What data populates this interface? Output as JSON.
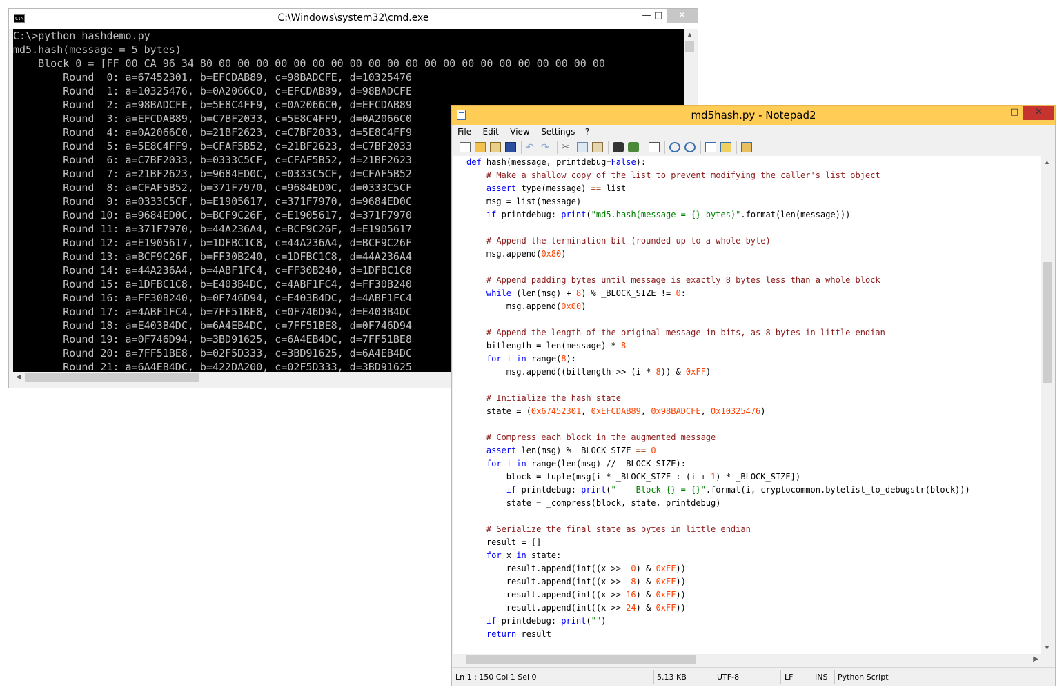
{
  "cmd": {
    "title": "C:\\Windows\\system32\\cmd.exe",
    "lines": [
      "C:\\>python hashdemo.py",
      "md5.hash(message = 5 bytes)",
      "    Block 0 = [FF 00 CA 96 34 80 00 00 00 00 00 00 00 00 00 00 00 00 00 00 00 00 00 00 00 00 00",
      "        Round  0: a=67452301, b=EFCDAB89, c=98BADCFE, d=10325476",
      "        Round  1: a=10325476, b=0A2066C0, c=EFCDAB89, d=98BADCFE",
      "        Round  2: a=98BADCFE, b=5E8C4FF9, c=0A2066C0, d=EFCDAB89",
      "        Round  3: a=EFCDAB89, b=C7BF2033, c=5E8C4FF9, d=0A2066C0",
      "        Round  4: a=0A2066C0, b=21BF2623, c=C7BF2033, d=5E8C4FF9",
      "        Round  5: a=5E8C4FF9, b=CFAF5B52, c=21BF2623, d=C7BF2033",
      "        Round  6: a=C7BF2033, b=0333C5CF, c=CFAF5B52, d=21BF2623",
      "        Round  7: a=21BF2623, b=9684ED0C, c=0333C5CF, d=CFAF5B52",
      "        Round  8: a=CFAF5B52, b=371F7970, c=9684ED0C, d=0333C5CF",
      "        Round  9: a=0333C5CF, b=E1905617, c=371F7970, d=9684ED0C",
      "        Round 10: a=9684ED0C, b=BCF9C26F, c=E1905617, d=371F7970",
      "        Round 11: a=371F7970, b=44A236A4, c=BCF9C26F, d=E1905617",
      "        Round 12: a=E1905617, b=1DFBC1C8, c=44A236A4, d=BCF9C26F",
      "        Round 13: a=BCF9C26F, b=FF30B240, c=1DFBC1C8, d=44A236A4",
      "        Round 14: a=44A236A4, b=4ABF1FC4, c=FF30B240, d=1DFBC1C8",
      "        Round 15: a=1DFBC1C8, b=E403B4DC, c=4ABF1FC4, d=FF30B240",
      "        Round 16: a=FF30B240, b=0F746D94, c=E403B4DC, d=4ABF1FC4",
      "        Round 17: a=4ABF1FC4, b=7FF51BE8, c=0F746D94, d=E403B4DC",
      "        Round 18: a=E403B4DC, b=6A4EB4DC, c=7FF51BE8, d=0F746D94",
      "        Round 19: a=0F746D94, b=3BD91625, c=6A4EB4DC, d=7FF51BE8",
      "        Round 20: a=7FF51BE8, b=02F5D333, c=3BD91625, d=6A4EB4DC",
      "        Round 21: a=6A4EB4DC, b=422DA200, c=02F5D333, d=3BD91625"
    ]
  },
  "notepad": {
    "title": "md5hash.py - Notepad2",
    "menu": [
      "File",
      "Edit",
      "View",
      "Settings",
      "?"
    ],
    "toolbar_icons": [
      "new-file-icon",
      "open-file-icon",
      "browse-icon",
      "save-icon",
      "undo-icon",
      "redo-icon",
      "cut-icon",
      "copy-icon",
      "paste-icon",
      "find-icon",
      "replace-icon",
      "word-wrap-icon",
      "zoom-in-icon",
      "zoom-out-icon",
      "scheme-icon",
      "customize-icon",
      "exit-icon"
    ],
    "status": {
      "position": "Ln 1 : 150   Col 1   Sel 0",
      "size": "5.13 KB",
      "encoding": "UTF-8",
      "eol": "LF",
      "mode": "INS",
      "lexer": "Python Script"
    }
  }
}
